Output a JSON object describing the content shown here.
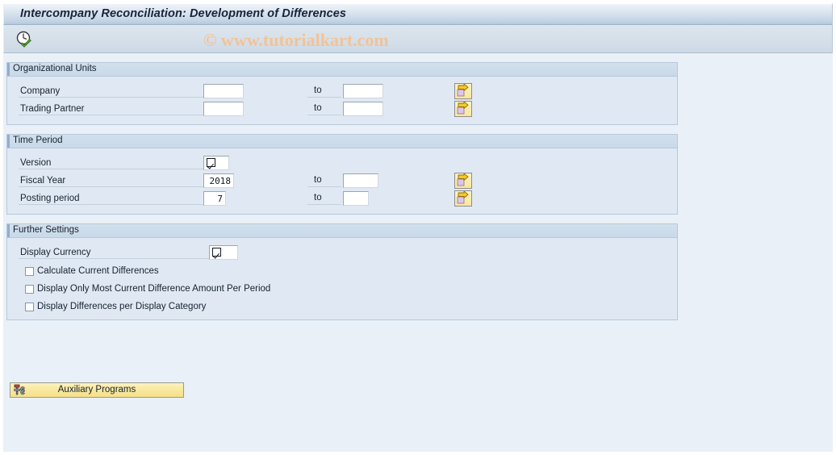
{
  "window": {
    "title": "Intercompany Reconciliation: Development of Differences"
  },
  "toolbar": {
    "execute_icon": "clock-check-icon",
    "execute_tooltip": "Execute",
    "watermark": "© www.tutorialkart.com"
  },
  "sections": {
    "org_units": {
      "title": "Organizational Units",
      "rows": [
        {
          "label": "Company",
          "value": "",
          "to_label": "to",
          "to_value": "",
          "multi_select_icon": "multi-selection-arrow-icon"
        },
        {
          "label": "Trading Partner",
          "value": "",
          "to_label": "to",
          "to_value": "",
          "multi_select_icon": "multi-selection-arrow-icon"
        }
      ]
    },
    "time_period": {
      "title": "Time Period",
      "rows": [
        {
          "label": "Version",
          "value": "",
          "value_help_icon": "checked-box-glyph-icon"
        },
        {
          "label": "Fiscal Year",
          "value": "2018",
          "to_label": "to",
          "to_value": "",
          "multi_select_icon": "multi-selection-arrow-icon"
        },
        {
          "label": "Posting period",
          "value": "7",
          "to_label": "to",
          "to_value": "",
          "multi_select_icon": "multi-selection-arrow-icon"
        }
      ]
    },
    "further_settings": {
      "title": "Further Settings",
      "currency_row": {
        "label": "Display Currency",
        "value": "",
        "value_help_icon": "checked-box-glyph-icon"
      },
      "checkboxes": [
        {
          "label": "Calculate Current Differences",
          "checked": false
        },
        {
          "label": "Display Only Most Current Difference Amount Per Period",
          "checked": false
        },
        {
          "label": "Display Differences per Display Category",
          "checked": false
        }
      ]
    }
  },
  "footer": {
    "auxiliary_button": {
      "label": "Auxiliary Programs",
      "icon": "tools-wrench-icon"
    }
  },
  "colors": {
    "title_bar": "#c3d3e3",
    "toolbar": "#d4dfe9",
    "canvas": "#eaf0f7",
    "group_body": "#e0e9f3",
    "group_header": "#c8d9e9",
    "group_border": "#b6c8da",
    "button_yellow": "#f8e79a",
    "watermark": "#f2c396",
    "text": "#16222f"
  }
}
